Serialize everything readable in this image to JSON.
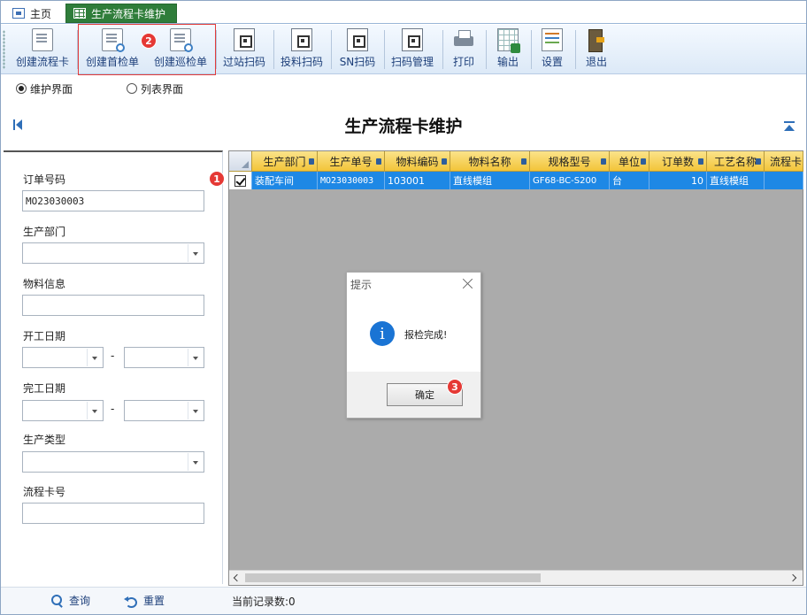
{
  "tabs": [
    {
      "label": "主页",
      "icon": "home-icon"
    },
    {
      "label": "生产流程卡维护",
      "icon": "grid-icon",
      "active": true
    }
  ],
  "toolbar": {
    "buttons": [
      {
        "label": "创建流程卡",
        "icon": "doc-ok-icon"
      },
      {
        "label": "创建首检单",
        "icon": "doc-search-icon"
      },
      {
        "label": "创建巡检单",
        "icon": "doc-search-icon"
      },
      {
        "label": "过站扫码",
        "icon": "scan-icon"
      },
      {
        "label": "投料扫码",
        "icon": "scan-icon"
      },
      {
        "label": "SN扫码",
        "icon": "scan-icon"
      },
      {
        "label": "扫码管理",
        "icon": "scan-manage-icon"
      },
      {
        "label": "打印",
        "icon": "printer-icon"
      },
      {
        "label": "输出",
        "icon": "export-excel-icon"
      },
      {
        "label": "设置",
        "icon": "settings-icon"
      },
      {
        "label": "退出",
        "icon": "exit-door-icon"
      }
    ]
  },
  "view_mode": {
    "options": [
      "维护界面",
      "列表界面"
    ],
    "selected": "维护界面"
  },
  "page_title": "生产流程卡维护",
  "filters": {
    "order_no": {
      "label": "订单号码",
      "value": "MO23030003"
    },
    "department": {
      "label": "生产部门",
      "value": ""
    },
    "material": {
      "label": "物料信息",
      "value": ""
    },
    "start_date": {
      "label": "开工日期",
      "from": "",
      "to": "",
      "separator": "-"
    },
    "end_date": {
      "label": "完工日期",
      "from": "",
      "to": "",
      "separator": "-"
    },
    "production_type": {
      "label": "生产类型",
      "value": ""
    },
    "card_no": {
      "label": "流程卡号",
      "value": ""
    }
  },
  "grid": {
    "columns": [
      "生产部门",
      "生产单号",
      "物料编码",
      "物料名称",
      "规格型号",
      "单位",
      "订单数",
      "工艺名称",
      "流程卡"
    ],
    "rows": [
      {
        "selected": true,
        "cells": [
          "装配车间",
          "MO23030003",
          "103001",
          "直线模组",
          "GF68-BC-S200",
          "台",
          "10",
          "直线模组",
          ""
        ]
      }
    ]
  },
  "dialog": {
    "title": "提示",
    "message": "报检完成!",
    "ok_label": "确定"
  },
  "bottom": {
    "query_label": "查询",
    "reset_label": "重置",
    "record_count": "当前记录数:0"
  },
  "annotations": [
    "1",
    "2",
    "3"
  ],
  "colors": {
    "active_tab": "#2f7d3a",
    "header_gold": "#f2c335",
    "row_selected": "#1e88e5",
    "badge_red": "#e53935",
    "highlight_red": "#e23b3b"
  }
}
